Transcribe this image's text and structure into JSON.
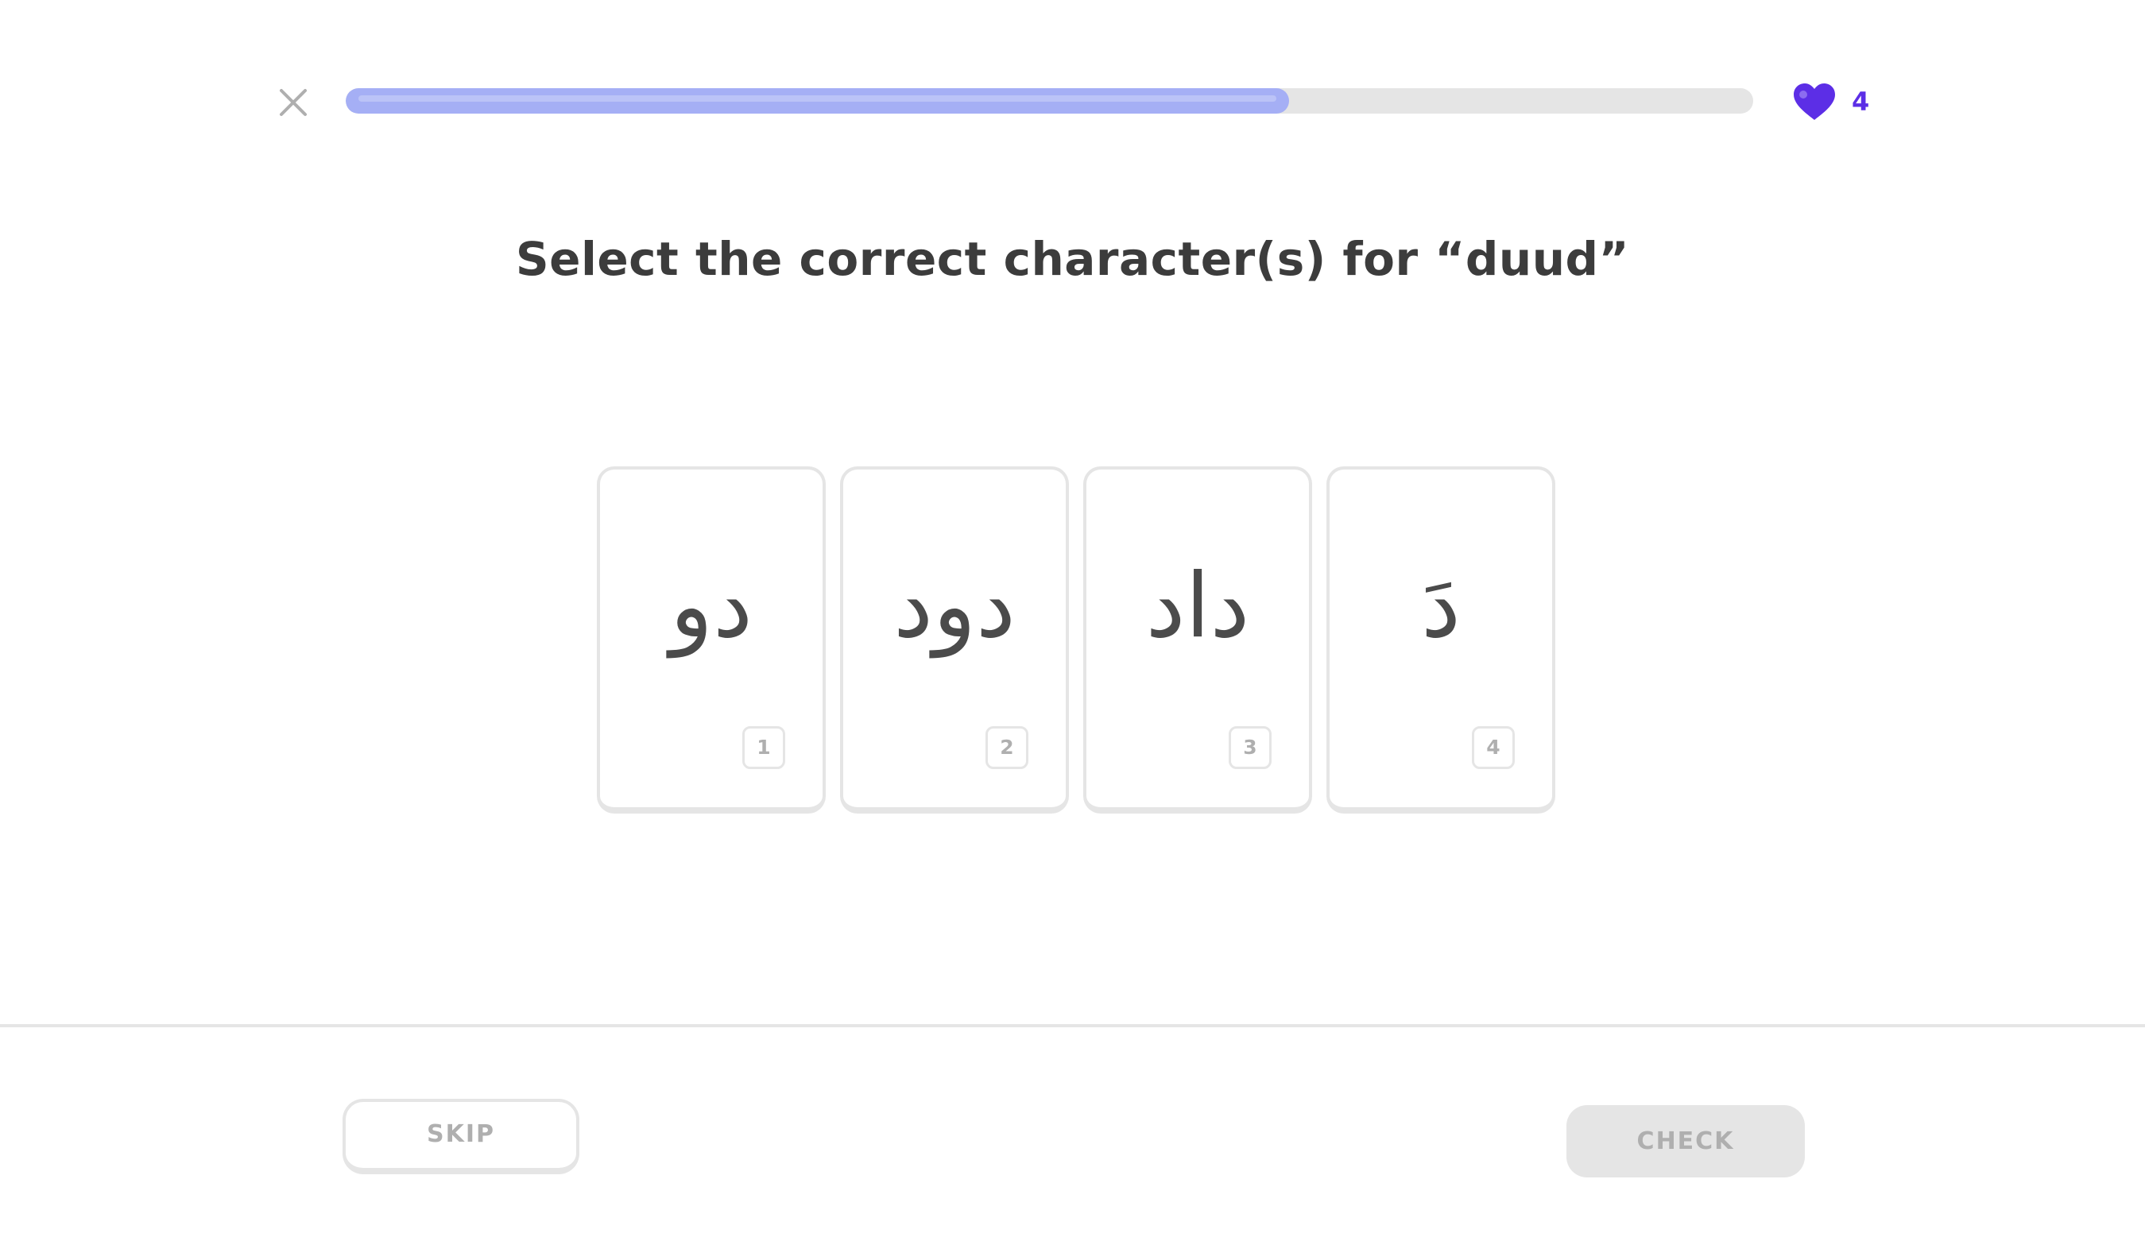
{
  "header": {
    "close_icon": "close-icon",
    "progress": {
      "fraction": 0.67,
      "fill_color": "#a5aff5",
      "track_color": "#e5e5e5"
    },
    "hearts": {
      "icon": "heart-icon",
      "count": "4",
      "color": "#5c2ee6"
    }
  },
  "challenge": {
    "prompt": "Select the correct character(s) for “duud”",
    "choices": [
      {
        "text": "دو",
        "key": "1"
      },
      {
        "text": "دود",
        "key": "2"
      },
      {
        "text": "داد",
        "key": "3"
      },
      {
        "text": "دَ",
        "key": "4"
      }
    ]
  },
  "footer": {
    "skip_label": "SKIP",
    "check_label": "CHECK"
  }
}
